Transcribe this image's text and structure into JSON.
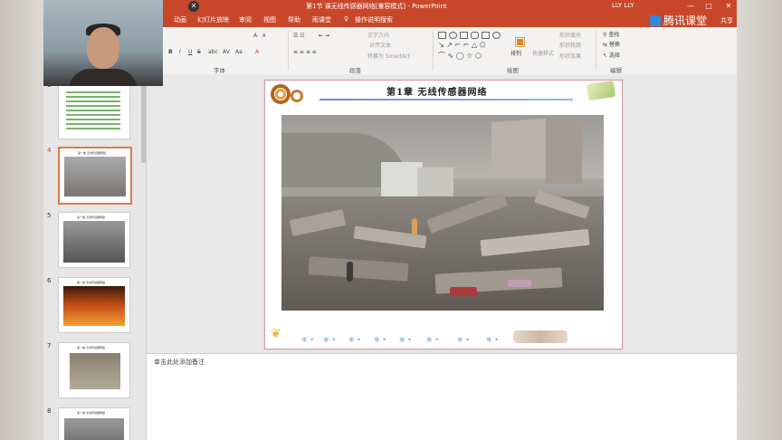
{
  "window": {
    "title": "第1节 课无线传感器网络[兼容模式] - PowerPoint",
    "user": "LLY LLY",
    "controls": [
      "—",
      "□",
      "✕"
    ]
  },
  "tabs": [
    "动画",
    "幻灯片放映",
    "审阅",
    "视图",
    "帮助",
    "雨课堂",
    "操作说明搜索"
  ],
  "brand": {
    "name": "腾讯课堂",
    "share": "共享"
  },
  "ribbon": {
    "font_group": "字体",
    "paragraph_group": "段落",
    "drawing_group": "绘图",
    "editing_group": "编辑",
    "font_size_inc": "A",
    "font_size_dec": "A",
    "font_buttons": [
      "B",
      "I",
      "U",
      "S",
      "abc",
      "AV",
      "Aa",
      "A"
    ],
    "text_direction": "文字方向",
    "align_text": "对齐文本",
    "convert_smartart": "转换为 SmartArt",
    "arrange": "排列",
    "quick_styles": "快速样式",
    "shape_fill": "形状填充",
    "shape_outline": "形状轮廓",
    "shape_effects": "形状效果",
    "find": "查找",
    "replace": "替换",
    "select": "选择"
  },
  "thumbnails": [
    {
      "num": "3",
      "title": ""
    },
    {
      "num": "4",
      "title": "第一章 无线传感器网络"
    },
    {
      "num": "5",
      "title": "第一章 无线传感器网络"
    },
    {
      "num": "6",
      "title": "第一章 无线传感器网络"
    },
    {
      "num": "7",
      "title": "第一章 无线传感器网络"
    },
    {
      "num": "8",
      "title": "第一章 无线传感器网络"
    }
  ],
  "slide": {
    "title": "第1章  无线传感器网络"
  },
  "notes": {
    "placeholder": "单击此处添加备注"
  },
  "colors": {
    "accent": "#c8472a",
    "selected_thumb": "#e07a4a"
  }
}
